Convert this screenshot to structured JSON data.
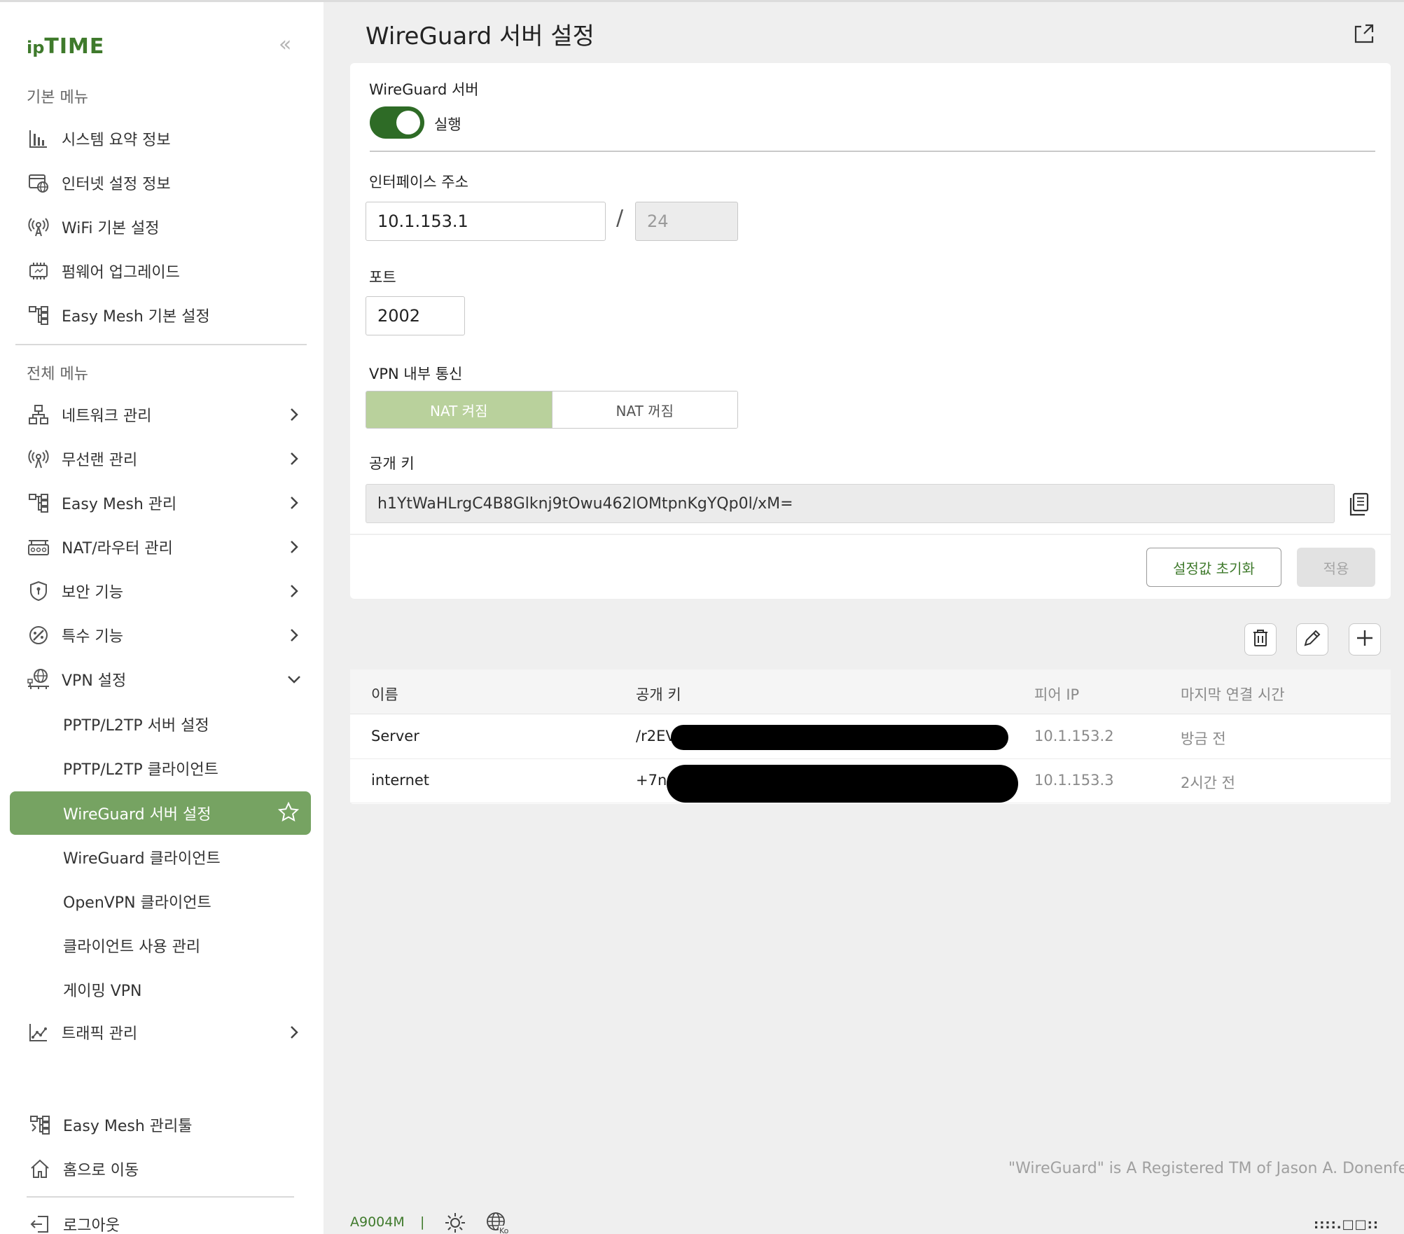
{
  "brand": {
    "ip": "ip",
    "time": "TIME"
  },
  "sidebar": {
    "collapse_glyph": "«",
    "basic_menu_label": "기본 메뉴",
    "basic_items": [
      {
        "label": "시스템 요약 정보",
        "icon": "bar-chart-icon"
      },
      {
        "label": "인터넷 설정 정보",
        "icon": "internet-settings-icon"
      },
      {
        "label": "WiFi 기본 설정",
        "icon": "wifi-antenna-icon"
      },
      {
        "label": "펌웨어 업그레이드",
        "icon": "firmware-chip-icon"
      },
      {
        "label": "Easy Mesh 기본 설정",
        "icon": "mesh-tree-icon"
      }
    ],
    "full_menu_label": "전체 메뉴",
    "full_items": [
      {
        "label": "네트워크 관리",
        "icon": "network-icon"
      },
      {
        "label": "무선랜 관리",
        "icon": "wireless-icon"
      },
      {
        "label": "Easy Mesh 관리",
        "icon": "mesh-tree-icon"
      },
      {
        "label": "NAT/라우터 관리",
        "icon": "router-icon"
      },
      {
        "label": "보안 기능",
        "icon": "shield-icon"
      },
      {
        "label": "특수 기능",
        "icon": "special-function-icon"
      },
      {
        "label": "VPN 설정",
        "icon": "vpn-globe-icon"
      }
    ],
    "vpn_sub_items": [
      {
        "label": "PPTP/L2TP 서버 설정"
      },
      {
        "label": "PPTP/L2TP 클라이언트"
      },
      {
        "label": "WireGuard 서버 설정"
      },
      {
        "label": "WireGuard 클라이언트"
      },
      {
        "label": "OpenVPN 클라이언트"
      },
      {
        "label": "클라이언트 사용 관리"
      },
      {
        "label": "게이밍 VPN"
      }
    ],
    "traffic_label": "트래픽 관리",
    "bottom_items": [
      {
        "label": "Easy Mesh 관리툴",
        "icon": "mesh-tool-icon"
      },
      {
        "label": "홈으로 이동",
        "icon": "home-icon"
      },
      {
        "label": "로그아웃",
        "icon": "logout-icon"
      }
    ]
  },
  "main": {
    "title": "WireGuard 서버 설정",
    "server_label": "WireGuard 서버",
    "server_toggle_state": "실행",
    "interface_label": "인터페이스 주소",
    "interface_address": "10.1.153.1",
    "interface_slash": "/",
    "interface_prefix": "24",
    "port_label": "포트",
    "port_value": "2002",
    "vpn_internal_label": "VPN 내부 통신",
    "nat_on": "NAT 켜짐",
    "nat_off": "NAT 꺼짐",
    "public_key_label": "공개 키",
    "public_key": "h1YtWaHLrgC4B8Glknj9tOwu462lOMtpnKgYQp0l/xM=",
    "reset_button": "설정값 초기화",
    "apply_button": "적용"
  },
  "peers_table": {
    "headers": [
      "이름",
      "공개 키",
      "피어 IP",
      "마지막 연결 시간"
    ],
    "rows": [
      {
        "name": "Server",
        "key_visible": "/r2EV",
        "ip": "10.1.153.2",
        "last": "방금 전"
      },
      {
        "name": "internet",
        "key_visible": "+7nC",
        "ip": "10.1.153.3",
        "last": "2시간 전"
      }
    ]
  },
  "footer": {
    "trademark": "\"WireGuard\" is A Registered TM of Jason A. Donenfeld.",
    "model": "A9004M",
    "separator": "|",
    "language_code": "Ko",
    "right_logo": "::::.□□::"
  },
  "colors": {
    "accent": "#3f7a2c",
    "active_nav": "#76a362",
    "toggle_on": "#2e6b26",
    "nat_on_bg": "#b9d19c"
  }
}
